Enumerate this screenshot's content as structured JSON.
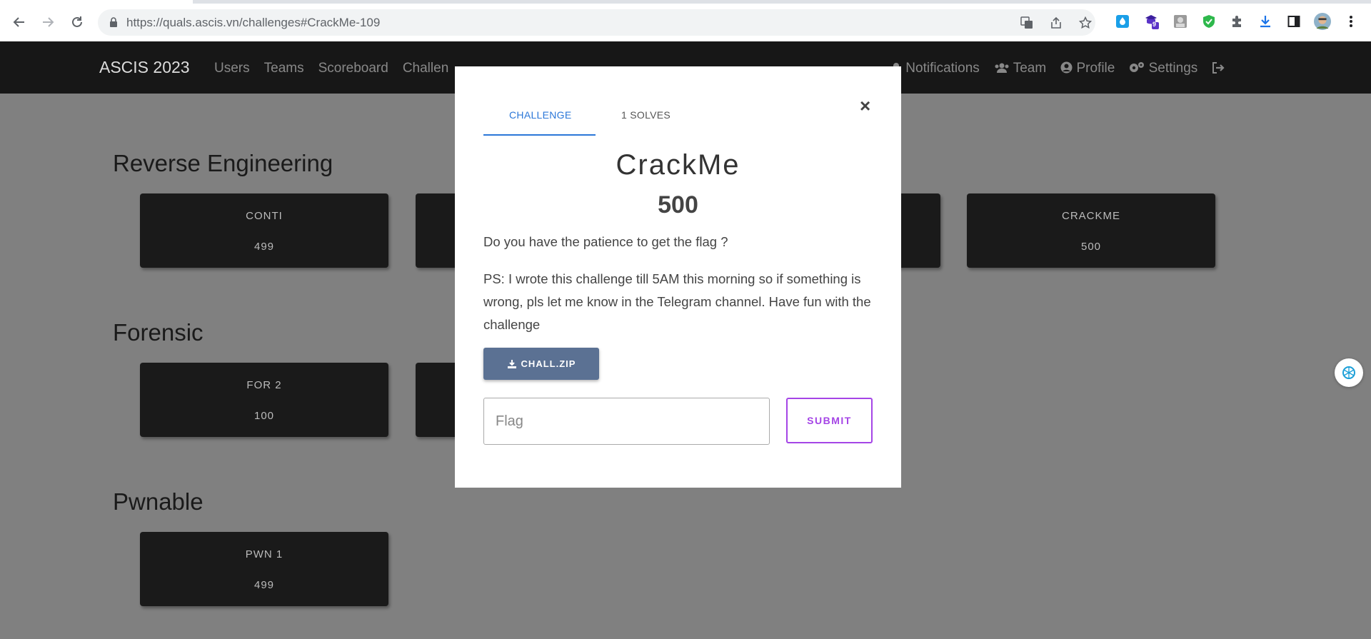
{
  "browser": {
    "url_host": "https://quals.ascis.vn",
    "url_path": "/challenges#CrackMe-109",
    "extension_badge": "9"
  },
  "navbar": {
    "brand": "ASCIS 2023",
    "links": [
      "Users",
      "Teams",
      "Scoreboard",
      "Challen"
    ],
    "right": {
      "notifications": "Notifications",
      "team": "Team",
      "profile": "Profile",
      "settings": "Settings"
    }
  },
  "categories": [
    {
      "title": "Reverse Engineering",
      "challenges": [
        {
          "name": "CONTI",
          "value": "499"
        },
        {
          "name": "CRACKME",
          "value": "500"
        }
      ]
    },
    {
      "title": "Forensic",
      "challenges": [
        {
          "name": "FOR 2",
          "value": "100"
        }
      ]
    },
    {
      "title": "Pwnable",
      "challenges": [
        {
          "name": "PWN 1",
          "value": "499"
        }
      ]
    }
  ],
  "modal": {
    "tab_challenge": "CHALLENGE",
    "tab_solves": "1 SOLVES",
    "close": "×",
    "name": "CrackMe",
    "value": "500",
    "description_1": "Do you have the patience to get the flag ?",
    "description_2": "PS: I wrote this challenge till 5AM this morning so if something is wrong, pls let me know in the Telegram channel. Have fun with the challenge",
    "file_label": "CHALL.ZIP",
    "flag_placeholder": "Flag",
    "submit_label": "SUBMIT"
  }
}
